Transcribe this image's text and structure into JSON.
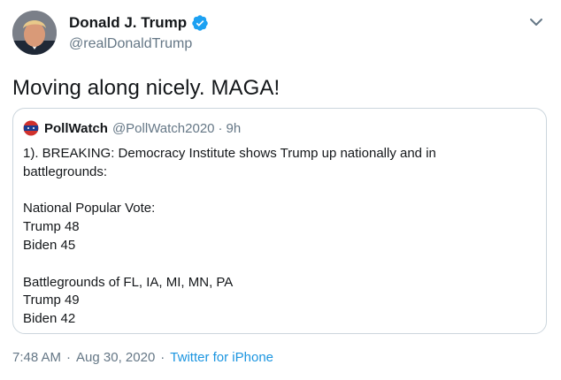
{
  "author": {
    "display_name": "Donald J. Trump",
    "handle": "@realDonaldTrump",
    "verified": true
  },
  "tweet": {
    "text": "Moving along nicely. MAGA!"
  },
  "quoted_tweet": {
    "display_name": "PollWatch",
    "handle": "@PollWatch2020",
    "separator": "·",
    "time": "9h",
    "lines": [
      "1). BREAKING: Democracy Institute shows Trump up nationally and in",
      "battlegrounds:",
      "",
      "National Popular Vote:",
      "Trump 48",
      "Biden 45",
      "",
      "Battlegrounds of FL, IA, MI, MN, PA",
      "Trump 49",
      "Biden 42"
    ]
  },
  "footer": {
    "time": "7:48 AM",
    "date": "Aug 30, 2020",
    "separator": "·",
    "source": "Twitter for iPhone"
  },
  "icons": {
    "verified": "verified-badge-icon",
    "menu": "chevron-down-icon"
  },
  "colors": {
    "verified_blue": "#1da1f2",
    "link_blue": "#1b95e0",
    "secondary_text": "#657786",
    "border": "#ccd6dd"
  }
}
